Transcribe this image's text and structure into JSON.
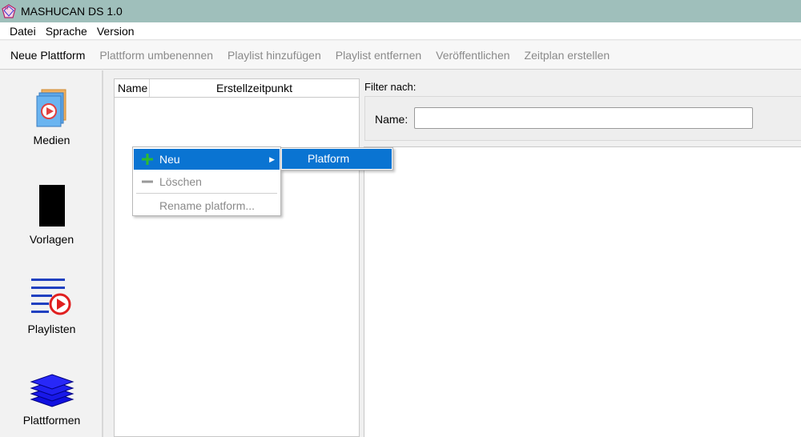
{
  "window": {
    "title": "MASHUCAN DS 1.0"
  },
  "menubar": [
    "Datei",
    "Sprache",
    "Version"
  ],
  "toolbar": {
    "new_platform": "Neue Plattform",
    "rename_platform": "Plattform umbenennen",
    "add_playlist": "Playlist hinzufügen",
    "remove_playlist": "Playlist entfernen",
    "publish": "Veröffentlichen",
    "create_schedule": "Zeitplan erstellen"
  },
  "sidebar": {
    "media": "Medien",
    "templates": "Vorlagen",
    "playlists": "Playlisten",
    "platforms": "Plattformen"
  },
  "tree": {
    "columns": {
      "name": "Name",
      "created": "Erstellzeitpunkt"
    }
  },
  "filter": {
    "heading": "Filter nach:",
    "name_label": "Name:",
    "name_value": ""
  },
  "context_menu": {
    "new": "Neu",
    "delete": "Löschen",
    "rename": "Rename platform...",
    "submenu_platform": "Platform"
  },
  "colors": {
    "titlebar": "#9fbfbb",
    "highlight": "#0a74d2",
    "disabled_text": "#8a8a8a"
  }
}
